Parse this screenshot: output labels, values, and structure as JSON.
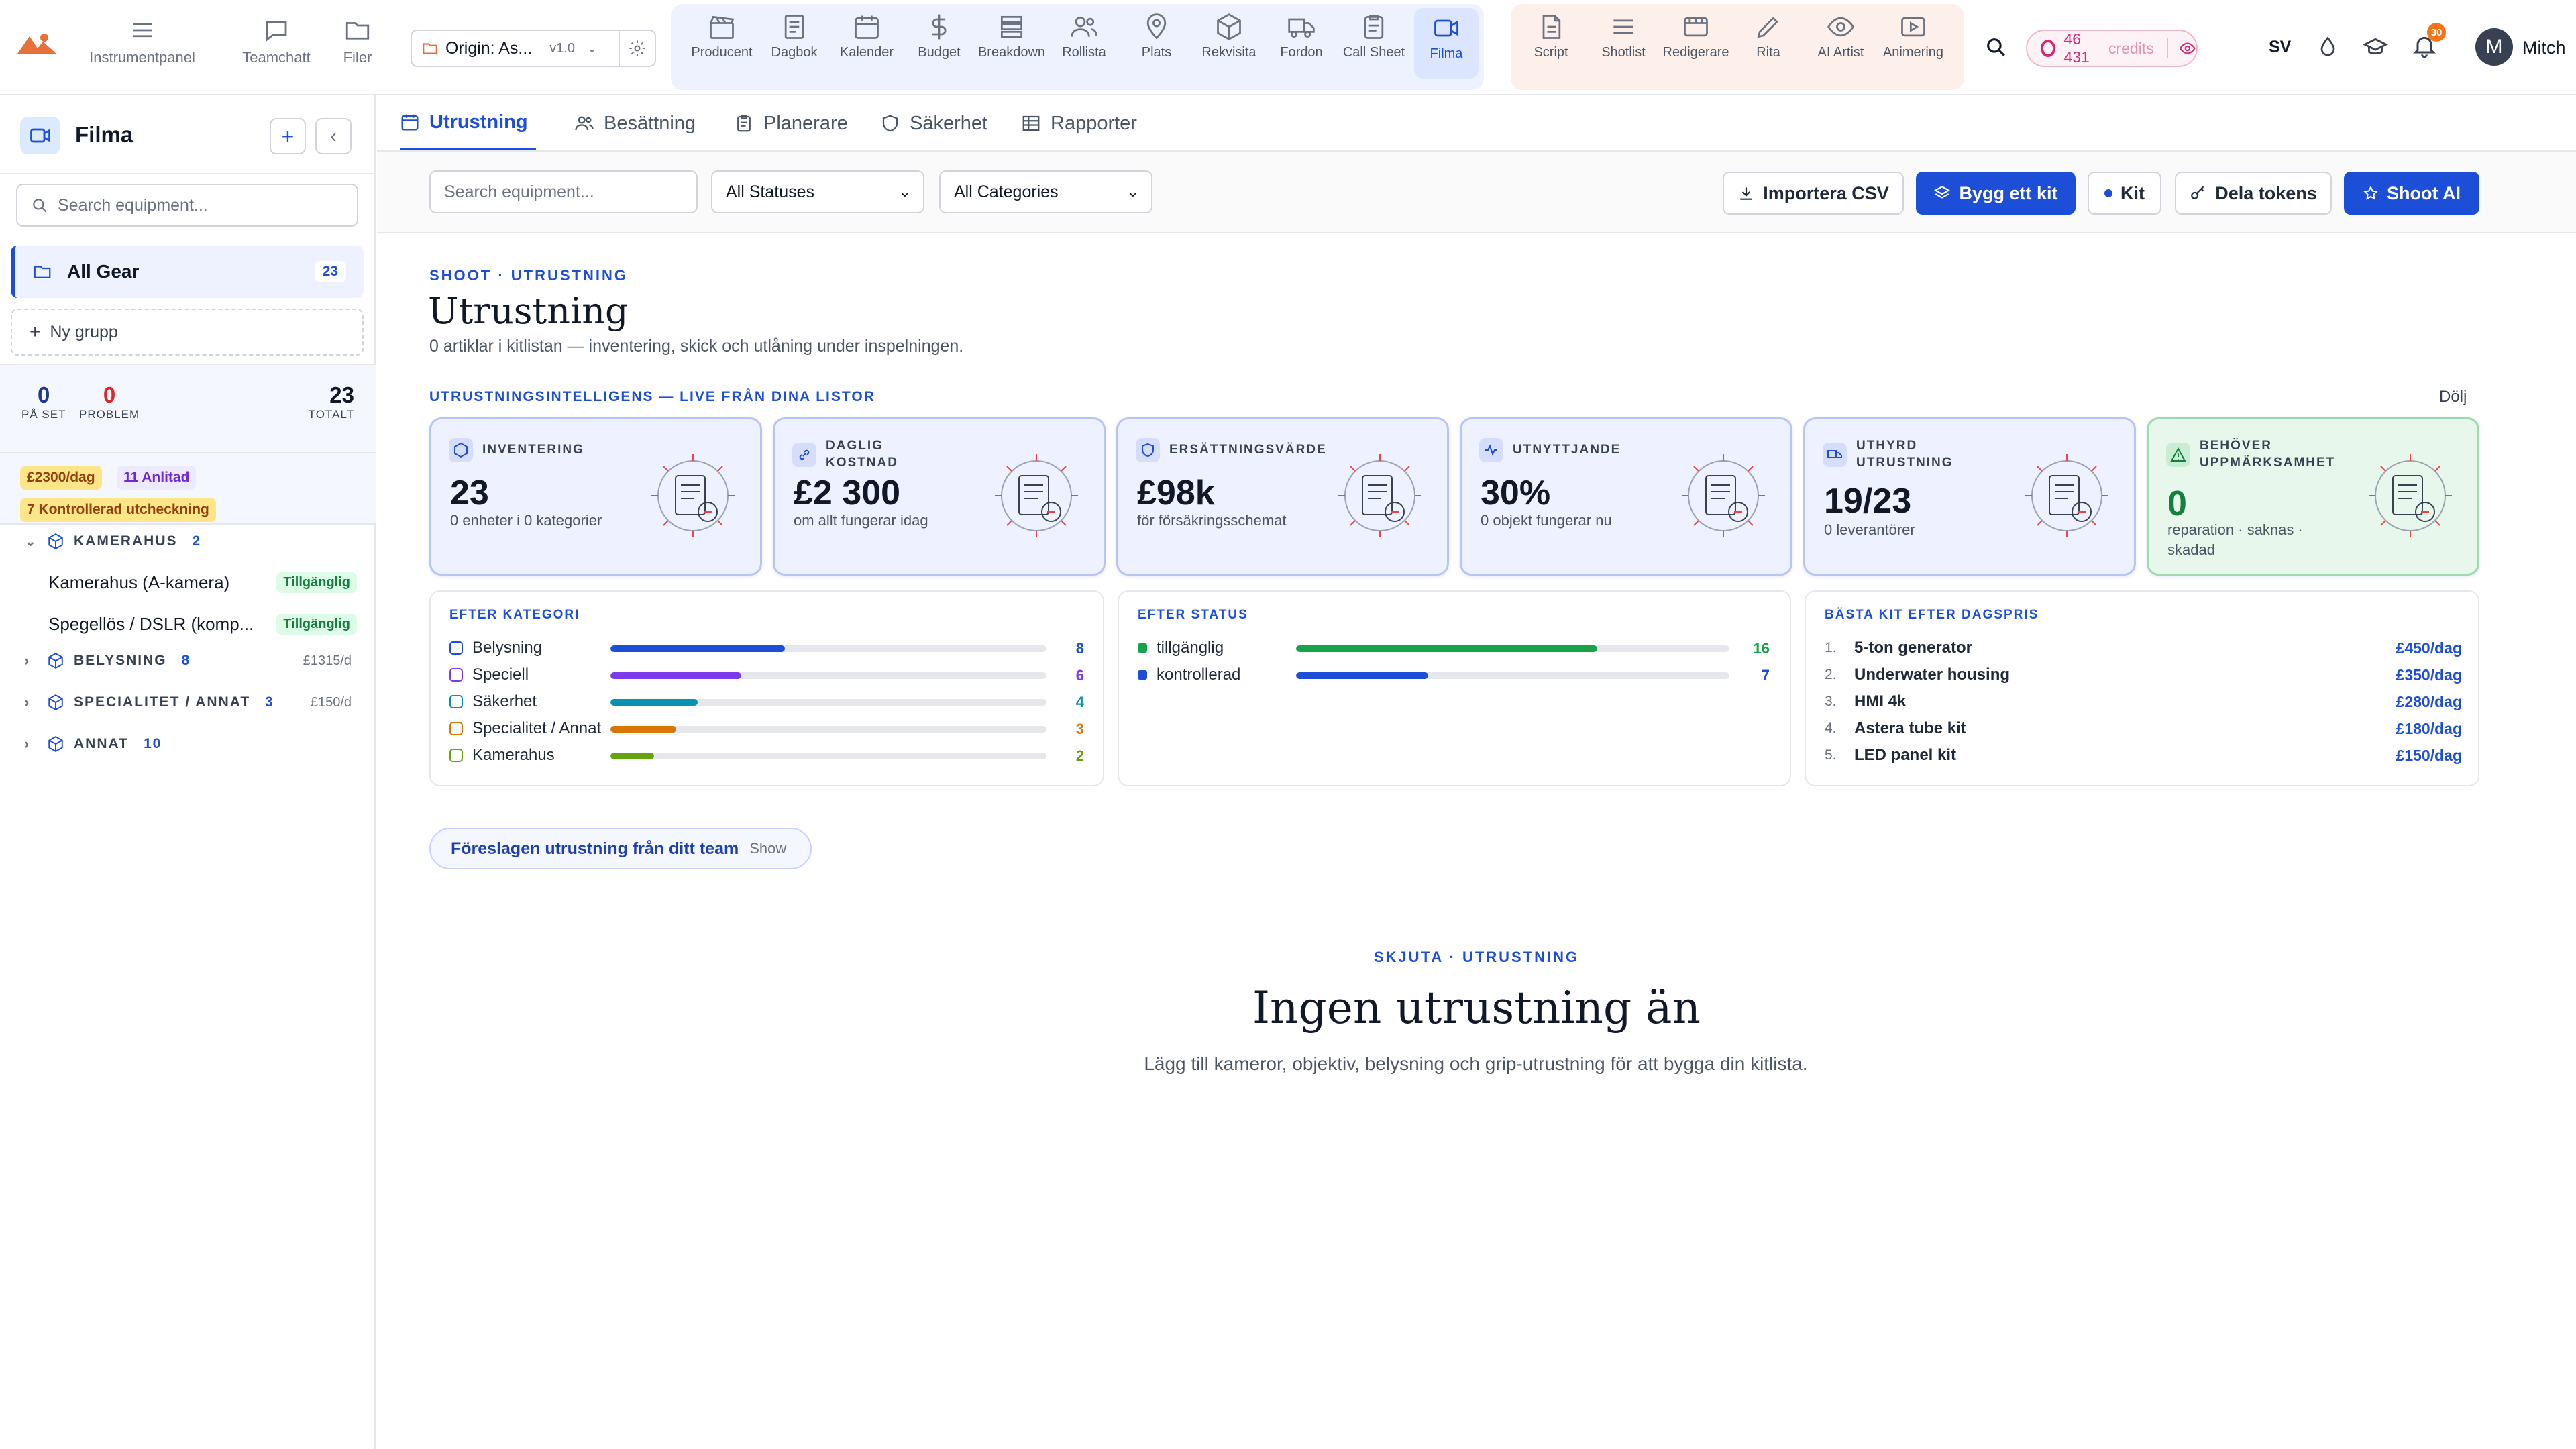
{
  "nav": {
    "dashboard": "Instrumentpanel",
    "chat": "Teamchatt",
    "files": "Filer"
  },
  "project": {
    "name": "Origin: As...",
    "version": "v1.0"
  },
  "production_tools": [
    {
      "label": "Producent",
      "icon": "clapper-icon"
    },
    {
      "label": "Dagbok",
      "icon": "journal-icon"
    },
    {
      "label": "Kalender",
      "icon": "calendar-icon"
    },
    {
      "label": "Budget",
      "icon": "dollar-icon"
    },
    {
      "label": "Breakdown",
      "icon": "list-icon"
    },
    {
      "label": "Rollista",
      "icon": "people-icon"
    },
    {
      "label": "Plats",
      "icon": "pin-icon"
    },
    {
      "label": "Rekvisita",
      "icon": "box-icon"
    },
    {
      "label": "Fordon",
      "icon": "truck-icon"
    },
    {
      "label": "Call Sheet",
      "icon": "clipboard-icon"
    },
    {
      "label": "Filma",
      "icon": "video-icon",
      "active": true
    }
  ],
  "creative_tools": [
    {
      "label": "Script",
      "icon": "document-icon"
    },
    {
      "label": "Shotlist",
      "icon": "lines-icon"
    },
    {
      "label": "Redigerare",
      "icon": "film-icon"
    },
    {
      "label": "Rita",
      "icon": "pencil-icon"
    },
    {
      "label": "AI Artist",
      "icon": "eye-icon"
    },
    {
      "label": "Animering",
      "icon": "play-icon"
    }
  ],
  "credits": {
    "amount": "46 431",
    "label": "credits"
  },
  "language": "SV",
  "notifications": {
    "count": "30"
  },
  "user": {
    "initial": "M",
    "name": "Mitch"
  },
  "sidebar": {
    "title": "Filma",
    "search_placeholder": "Search equipment...",
    "all_gear": {
      "label": "All Gear",
      "count": "23"
    },
    "new_group": "Ny grupp",
    "stats": [
      {
        "value": "0",
        "label": "PÅ SET"
      },
      {
        "value": "0",
        "label": "PROBLEM"
      },
      {
        "value": "23",
        "label": "TOTALT"
      }
    ],
    "badges": [
      "£2300/dag",
      "11 Anlitad",
      "7 Kontrollerad utcheckning"
    ],
    "groups": [
      {
        "name": "KAMERAHUS",
        "count": "2",
        "price": "",
        "expanded": true,
        "items": [
          {
            "name": "Kamerahus (A-kamera)",
            "status": "Tillgänglig"
          },
          {
            "name": "Spegellös / DSLR (komp...",
            "status": "Tillgänglig"
          }
        ]
      },
      {
        "name": "BELYSNING",
        "count": "8",
        "price": "£1315/d"
      },
      {
        "name": "SPECIALITET / ANNAT",
        "count": "3",
        "price": "£150/d"
      },
      {
        "name": "ANNAT",
        "count": "10",
        "price": ""
      }
    ]
  },
  "tabs": [
    "Utrustning",
    "Besättning",
    "Planerare",
    "Säkerhet",
    "Rapporter"
  ],
  "filters": {
    "search_placeholder": "Search equipment...",
    "status": "All Statuses",
    "category": "All Categories"
  },
  "actions": {
    "import": "Importera CSV",
    "build_kit": "Bygg ett kit",
    "kit": "Kit",
    "share": "Dela tokens",
    "ai": "Shoot AI"
  },
  "header": {
    "eyebrow": "SHOOT · UTRUSTNING",
    "title": "Utrustning",
    "subtitle": "0 artiklar i kitlistan — inventering, skick och utlåning under inspelningen."
  },
  "intel": {
    "title": "UTRUSTNINGSINTELLIGENS — LIVE FRÅN DINA LISTOR",
    "hide": "Dölj"
  },
  "cards": [
    {
      "label": "INVENTERING",
      "value": "23",
      "sub": "0 enheter i 0 kategorier"
    },
    {
      "label": "DAGLIG KOSTNAD",
      "value": "£2 300",
      "sub": "om allt fungerar idag"
    },
    {
      "label": "ERSÄTTNINGSVÄRDE",
      "value": "£98k",
      "sub": "för försäkringsschemat"
    },
    {
      "label": "UTNYTTJANDE",
      "value": "30%",
      "sub": "0 objekt fungerar nu"
    },
    {
      "label": "UTHYRD UTRUSTNING",
      "value": "19/23",
      "sub": "0 leverantörer"
    },
    {
      "label": "BEHÖVER UPPMÄRKSAMHET",
      "value": "0",
      "sub": "reparation · saknas · skadad"
    }
  ],
  "by_category": {
    "title": "EFTER KATEGORI",
    "max": 20,
    "rows": [
      {
        "name": "Belysning",
        "value": 8,
        "color": "#1d4ed8"
      },
      {
        "name": "Speciell",
        "value": 6,
        "color": "#7c3aed"
      },
      {
        "name": "Säkerhet",
        "value": 4,
        "color": "#0891b2"
      },
      {
        "name": "Specialitet / Annat",
        "value": 3,
        "color": "#d97706"
      },
      {
        "name": "Kamerahus",
        "value": 2,
        "color": "#65a30d"
      }
    ]
  },
  "by_status": {
    "title": "EFTER STATUS",
    "max": 23,
    "rows": [
      {
        "name": "tillgänglig",
        "value": 16,
        "color": "#16a34a"
      },
      {
        "name": "kontrollerad",
        "value": 7,
        "color": "#1d4ed8"
      }
    ]
  },
  "top_kits": {
    "title": "BÄSTA KIT EFTER DAGSPRIS",
    "rows": [
      {
        "n": "1.",
        "name": "5-ton generator",
        "price": "£450/dag"
      },
      {
        "n": "2.",
        "name": "Underwater housing",
        "price": "£350/dag"
      },
      {
        "n": "3.",
        "name": "HMI 4k",
        "price": "£280/dag"
      },
      {
        "n": "4.",
        "name": "Astera tube kit",
        "price": "£180/dag"
      },
      {
        "n": "5.",
        "name": "LED panel kit",
        "price": "£150/dag"
      }
    ]
  },
  "suggested": {
    "label": "Föreslagen utrustning från ditt team",
    "action": "Show"
  },
  "empty": {
    "eyebrow": "SKJUTA · UTRUSTNING",
    "title": "Ingen utrustning än",
    "text": "Lägg till kameror, objektiv, belysning och grip-utrustning för att bygga din kitlista."
  }
}
